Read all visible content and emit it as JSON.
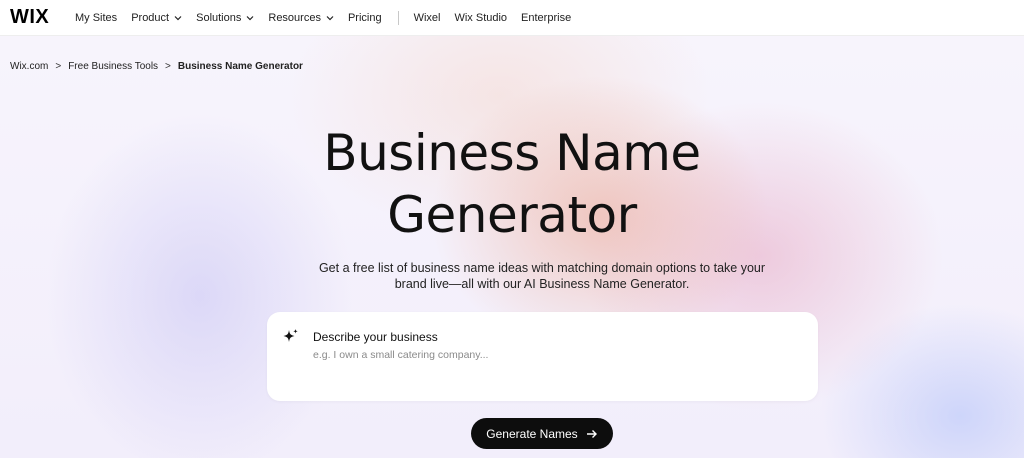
{
  "nav": {
    "logo": "WIX",
    "items": [
      {
        "label": "My Sites",
        "dropdown": false
      },
      {
        "label": "Product",
        "dropdown": true
      },
      {
        "label": "Solutions",
        "dropdown": true
      },
      {
        "label": "Resources",
        "dropdown": true
      },
      {
        "label": "Pricing",
        "dropdown": false
      }
    ],
    "secondary": [
      {
        "label": "Wixel"
      },
      {
        "label": "Wix Studio"
      },
      {
        "label": "Enterprise"
      }
    ]
  },
  "breadcrumb": {
    "items": [
      "Wix.com",
      "Free Business Tools"
    ],
    "separator": ">",
    "current": "Business Name Generator"
  },
  "hero": {
    "title_line1": "Business Name",
    "title_line2": "Generator",
    "subtitle": "Get a free list of business name ideas with matching domain options to take your brand live—all with our AI Business Name Generator."
  },
  "prompt": {
    "icon": "sparkle-icon",
    "label": "Describe your business",
    "value": "",
    "placeholder": "e.g. I own a small catering company..."
  },
  "cta": {
    "label": "Generate Names",
    "icon": "arrow-right-icon"
  },
  "colors": {
    "button_bg": "#0d0d0d",
    "nav_bg": "#ffffff",
    "card_bg": "#ffffff"
  }
}
